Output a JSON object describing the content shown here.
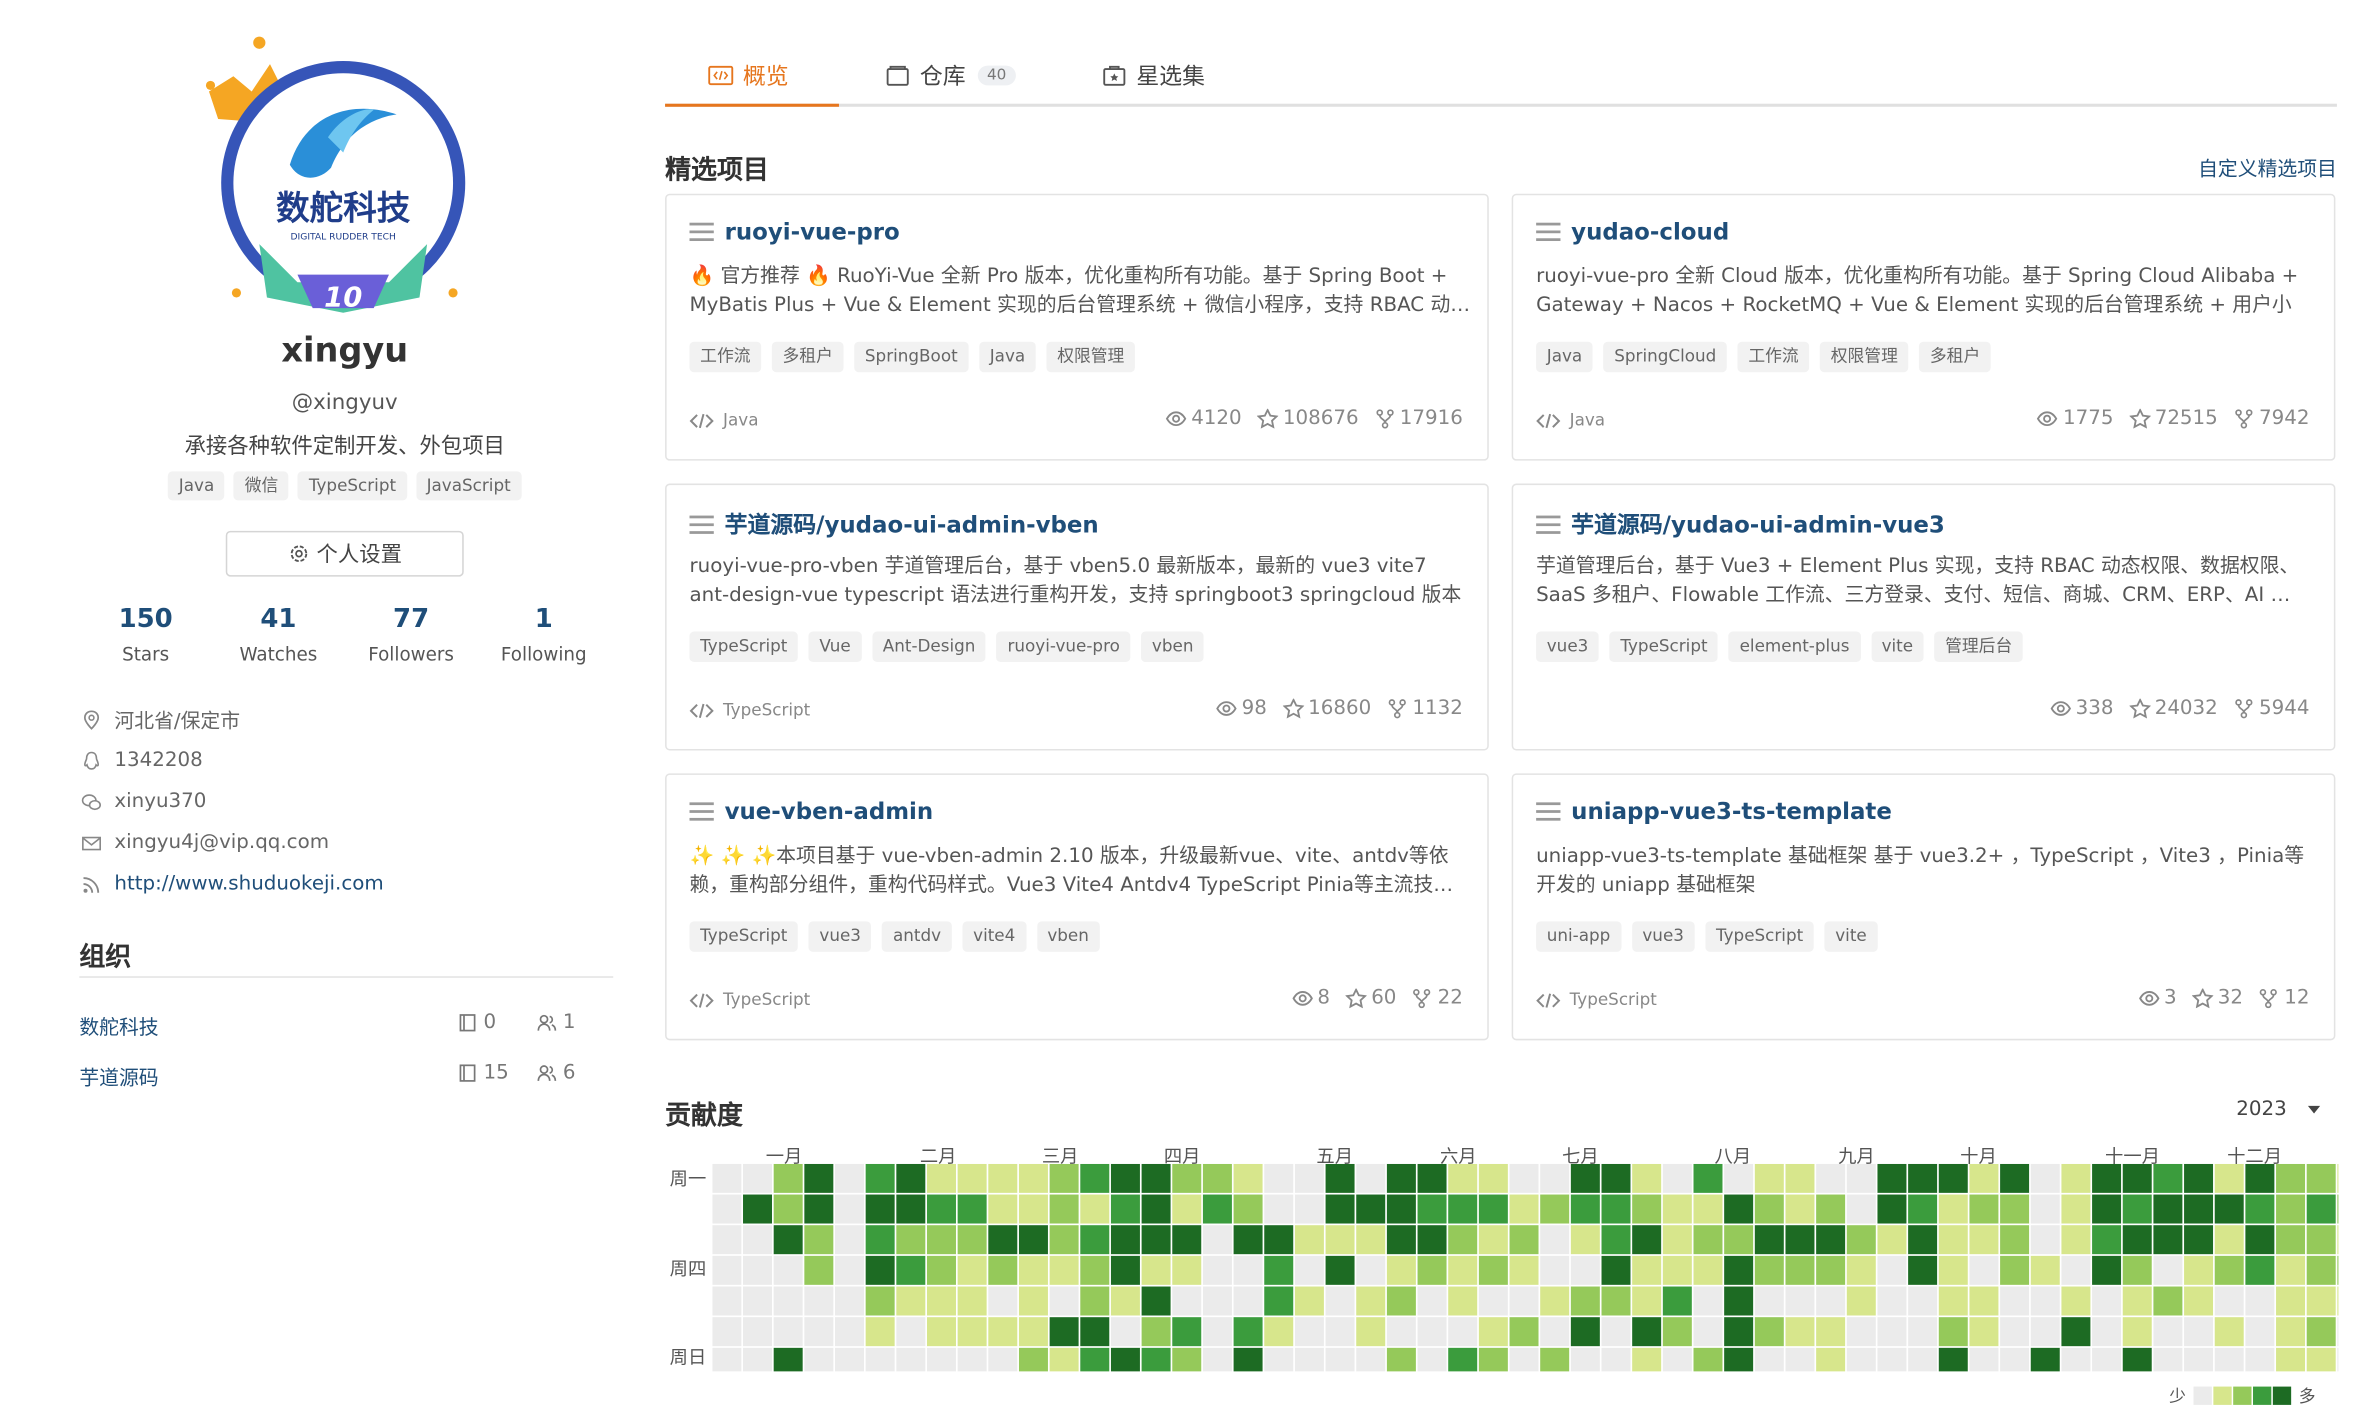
{
  "profile": {
    "avatar_logo_text": "数舵科技",
    "avatar_logo_sub": "DIGITAL RUDDER TECH",
    "avatar_badge": "10",
    "name": "xingyu",
    "handle": "@xingyuv",
    "bio": "承接各种软件定制开发、外包项目",
    "languages": [
      "Java",
      "微信",
      "TypeScript",
      "JavaScript"
    ],
    "settings_label": "个人设置",
    "stats": [
      {
        "value": "150",
        "label": "Stars"
      },
      {
        "value": "41",
        "label": "Watches"
      },
      {
        "value": "77",
        "label": "Followers"
      },
      {
        "value": "1",
        "label": "Following"
      }
    ],
    "location": "河北省/保定市",
    "qq": "1342208",
    "wechat": "xinyu370",
    "email": "xingyu4j@vip.qq.com",
    "website": "http://www.shuduokeji.com"
  },
  "orgs": {
    "title": "组织",
    "items": [
      {
        "name": "数舵科技",
        "repos": "0",
        "members": "1"
      },
      {
        "name": "芋道源码",
        "repos": "15",
        "members": "6"
      }
    ]
  },
  "tabs": [
    {
      "label": "概览",
      "count": ""
    },
    {
      "label": "仓库",
      "count": "40"
    },
    {
      "label": "星选集",
      "count": ""
    }
  ],
  "featured": {
    "title": "精选项目",
    "customize": "自定义精选项目",
    "projects": [
      {
        "name": "ruoyi-vue-pro",
        "desc": "🔥 官方推荐 🔥 RuoYi-Vue 全新 Pro 版本，优化重构所有功能。基于 Spring Boot + MyBatis Plus + Vue & Element 实现的后台管理系统 + 微信小程序，支持 RBAC 动…",
        "tags": [
          "工作流",
          "多租户",
          "SpringBoot",
          "Java",
          "权限管理"
        ],
        "lang": "Java",
        "watches": "4120",
        "stars": "108676",
        "forks": "17916"
      },
      {
        "name": "yudao-cloud",
        "desc": "ruoyi-vue-pro 全新 Cloud 版本，优化重构所有功能。基于 Spring Cloud Alibaba + Gateway + Nacos + RocketMQ + Vue & Element 实现的后台管理系统 + 用户小程…",
        "tags": [
          "Java",
          "SpringCloud",
          "工作流",
          "权限管理",
          "多租户"
        ],
        "lang": "Java",
        "watches": "1775",
        "stars": "72515",
        "forks": "7942"
      },
      {
        "name": "芋道源码/yudao-ui-admin-vben",
        "desc": "ruoyi-vue-pro-vben 芋道管理后台，基于 vben5.0 最新版本，最新的 vue3 vite7 ant-design-vue typescript 语法进行重构开发，支持 springboot3 springcloud 版本",
        "tags": [
          "TypeScript",
          "Vue",
          "Ant-Design",
          "ruoyi-vue-pro",
          "vben"
        ],
        "lang": "TypeScript",
        "watches": "98",
        "stars": "16860",
        "forks": "1132"
      },
      {
        "name": "芋道源码/yudao-ui-admin-vue3",
        "desc": "芋道管理后台，基于 Vue3 + Element Plus 实现，支持 RBAC 动态权限、数据权限、SaaS 多租户、Flowable 工作流、三方登录、支付、短信、商城、CRM、ERP、AI …",
        "tags": [
          "vue3",
          "TypeScript",
          "element-plus",
          "vite",
          "管理后台"
        ],
        "lang": "",
        "watches": "338",
        "stars": "24032",
        "forks": "5944"
      },
      {
        "name": "vue-vben-admin",
        "desc": "✨ ✨ ✨本项目基于 vue-vben-admin 2.10 版本，升级最新vue、vite、antdv等依赖，重构部分组件，重构代码样式。Vue3 Vite4 Antdv4 TypeScript Pinia等主流技…",
        "tags": [
          "TypeScript",
          "vue3",
          "antdv",
          "vite4",
          "vben"
        ],
        "lang": "TypeScript",
        "watches": "8",
        "stars": "60",
        "forks": "22"
      },
      {
        "name": "uniapp-vue3-ts-template",
        "desc": "uniapp-vue3-ts-template 基础框架 基于 vue3.2+ ，TypeScript ，Vite3 ，Pinia等开发的 uniapp 基础框架",
        "tags": [
          "uni-app",
          "vue3",
          "TypeScript",
          "vite"
        ],
        "lang": "TypeScript",
        "watches": "3",
        "stars": "32",
        "forks": "12"
      }
    ]
  },
  "contrib": {
    "title": "贡献度",
    "year": "2023",
    "months": [
      "一月",
      "二月",
      "三月",
      "四月",
      "五月",
      "六月",
      "七月",
      "八月",
      "九月",
      "十月",
      "十一月",
      "十二月"
    ],
    "days": [
      "周一",
      "周四",
      "周日"
    ],
    "legend_less": "少",
    "legend_more": "多",
    "colors": [
      "#ebebeb",
      "#d7e68c",
      "#95c95a",
      "#3b9c3d",
      "#1d6b23"
    ],
    "levels": [
      "0000000",
      "0400000",
      "2240004",
      "4422000",
      "0000000",
      "3434210",
      "4423100",
      "1322110",
      "1321110",
      "1142010",
      "1141112",
      "2221041",
      "3132243",
      "4344104",
      "4441423",
      "2141032",
      "2300000",
      "1240034",
      "0043310",
      "0010100",
      "4414000",
      "0410110",
      "4441202",
      "4342000",
      "1321103",
      "1312012",
      "0121020",
      "0200102",
      "4310240",
      "4334200",
      "1241141",
      "0111320",
      "3121002",
      "0424444",
      "1242020",
      "1142010",
      "0242011",
      "0021100",
      "4410000",
      "4344000",
      "4111124",
      "1210110",
      "4222000",
      "0001004",
      "1110140",
      "4434000",
      "4342114",
      "3440200",
      "4441100",
      "1412010",
      "4343000",
      "2221111",
      "2322121",
      "1212100"
    ]
  }
}
